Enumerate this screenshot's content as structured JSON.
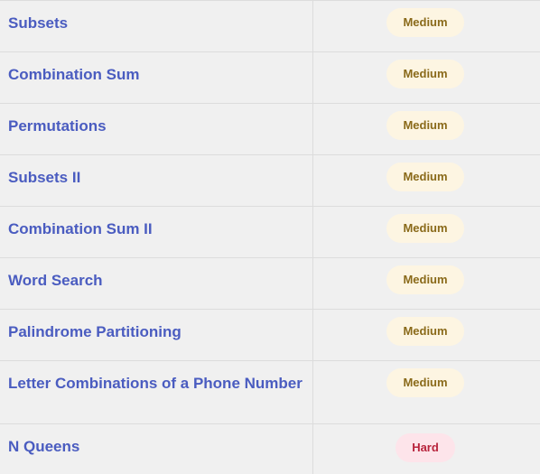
{
  "problems": [
    {
      "name": "Subsets",
      "difficulty": "Medium"
    },
    {
      "name": "Combination Sum",
      "difficulty": "Medium"
    },
    {
      "name": "Permutations",
      "difficulty": "Medium"
    },
    {
      "name": "Subsets II",
      "difficulty": "Medium"
    },
    {
      "name": "Combination Sum II",
      "difficulty": "Medium"
    },
    {
      "name": "Word Search",
      "difficulty": "Medium"
    },
    {
      "name": "Palindrome Partitioning",
      "difficulty": "Medium"
    },
    {
      "name": "Letter Combinations of a Phone Number",
      "difficulty": "Medium"
    },
    {
      "name": "N Queens",
      "difficulty": "Hard"
    }
  ],
  "colors": {
    "link": "#4a5cc0",
    "medium_bg": "#fdf5e2",
    "medium_text": "#8a6a1a",
    "hard_bg": "#fde4ea",
    "hard_text": "#b8243c"
  }
}
